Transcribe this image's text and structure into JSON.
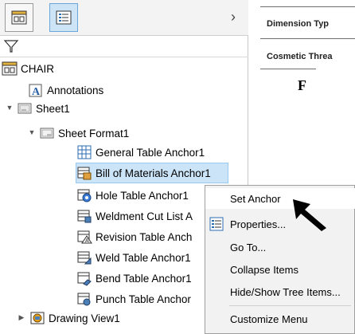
{
  "tree": {
    "root": "CHAIR",
    "annotations": "Annotations",
    "sheet": "Sheet1",
    "sheet_format": "Sheet Format1",
    "items": [
      "General Table Anchor1",
      "Bill of Materials Anchor1",
      "Hole Table Anchor1",
      "Weldment Cut List A",
      "Revision Table Anch",
      "Weld Table Anchor1",
      "Bend Table Anchor1",
      "Punch Table Anchor"
    ],
    "drawing_view": "Drawing View1"
  },
  "background_doc": {
    "row1": "Dimension Typ",
    "row2": "Cosmetic Threa",
    "fig": "F"
  },
  "context_menu": {
    "items": [
      "Set Anchor",
      "Properties...",
      "Go To...",
      "Collapse Items",
      "Hide/Show Tree Items...",
      "Customize Menu"
    ]
  },
  "colors": {
    "selection": "#cce4f7",
    "menu_bg": "#f2f2f2",
    "accent_blue": "#2b6cb0"
  }
}
